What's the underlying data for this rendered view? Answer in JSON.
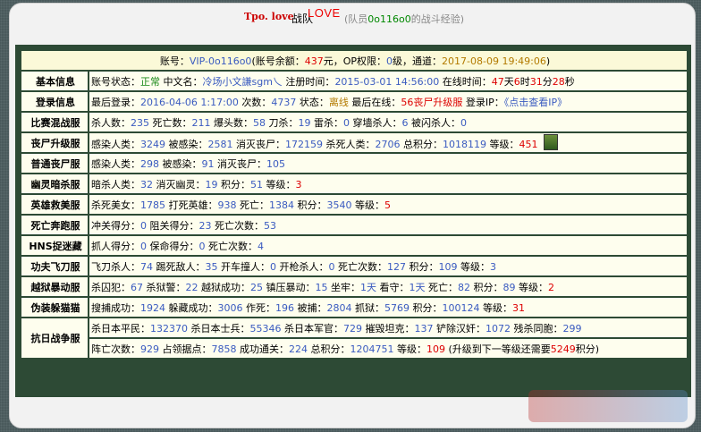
{
  "header": {
    "team": "Tpo. love",
    "team_suffix": "战队",
    "love": "LOVE",
    "sub_prefix": "(队员",
    "sub_name": "0o116o0",
    "sub_suffix": "的战斗经验)"
  },
  "info": {
    "p1": "账号：",
    "account": "VIP-0o116o0",
    "p2": "(账号余额：",
    "balance": "437",
    "p3": "元，OP权限：",
    "op": "0",
    "p4": "级，通道：",
    "date": "2017-08-09 19:49:06",
    "p5": ")"
  },
  "rows": [
    {
      "label": "基本信息",
      "parts": [
        {
          "t": "账号状态："
        },
        {
          "t": "正常",
          "c": "g"
        },
        {
          "t": " 中文名："
        },
        {
          "t": "冷场小文謙sgm乀",
          "c": "v"
        },
        {
          "t": " 注册时间："
        },
        {
          "t": "2015-03-01 14:56:00",
          "c": "v"
        },
        {
          "t": " 在线时间："
        },
        {
          "t": "47",
          "c": "r"
        },
        {
          "t": "天"
        },
        {
          "t": "6",
          "c": "r"
        },
        {
          "t": "时"
        },
        {
          "t": "31",
          "c": "r"
        },
        {
          "t": "分"
        },
        {
          "t": "28",
          "c": "r"
        },
        {
          "t": "秒"
        }
      ]
    },
    {
      "label": "登录信息",
      "parts": [
        {
          "t": "最后登录："
        },
        {
          "t": "2016-04-06 1:17:00",
          "c": "v"
        },
        {
          "t": " 次数："
        },
        {
          "t": "4737",
          "c": "v"
        },
        {
          "t": " 状态："
        },
        {
          "t": "离线",
          "c": "o"
        },
        {
          "t": " 最后在线："
        },
        {
          "t": "56丧尸升级服",
          "c": "r"
        },
        {
          "t": " 登录IP："
        },
        {
          "t": "《点击查看IP》",
          "c": "v"
        }
      ]
    },
    {
      "label": "比赛混战服",
      "parts": [
        {
          "t": "杀人数："
        },
        {
          "t": "235",
          "c": "v"
        },
        {
          "t": " 死亡数："
        },
        {
          "t": "211",
          "c": "v"
        },
        {
          "t": " 爆头数："
        },
        {
          "t": "58",
          "c": "v"
        },
        {
          "t": " 刀杀："
        },
        {
          "t": "19",
          "c": "v"
        },
        {
          "t": " 雷杀："
        },
        {
          "t": "0",
          "c": "v"
        },
        {
          "t": " 穿墙杀人："
        },
        {
          "t": "6",
          "c": "v"
        },
        {
          "t": " 被闪杀人："
        },
        {
          "t": "0",
          "c": "v"
        }
      ]
    },
    {
      "label": "丧尸升级服",
      "avatar": true,
      "parts": [
        {
          "t": "感染人类："
        },
        {
          "t": "3249",
          "c": "v"
        },
        {
          "t": " 被感染："
        },
        {
          "t": "2581",
          "c": "v"
        },
        {
          "t": " 消灭丧尸："
        },
        {
          "t": "172159",
          "c": "v"
        },
        {
          "t": " 杀死人类："
        },
        {
          "t": "2706",
          "c": "v"
        },
        {
          "t": " 总积分："
        },
        {
          "t": "1018119",
          "c": "v"
        },
        {
          "t": " 等级："
        },
        {
          "t": "451",
          "c": "r"
        }
      ]
    },
    {
      "label": "普通丧尸服",
      "parts": [
        {
          "t": "感染人类："
        },
        {
          "t": "298",
          "c": "v"
        },
        {
          "t": " 被感染："
        },
        {
          "t": "91",
          "c": "v"
        },
        {
          "t": " 消灭丧尸："
        },
        {
          "t": "105",
          "c": "v"
        }
      ]
    },
    {
      "label": "幽灵暗杀服",
      "parts": [
        {
          "t": "暗杀人类："
        },
        {
          "t": "32",
          "c": "v"
        },
        {
          "t": " 消灭幽灵："
        },
        {
          "t": "19",
          "c": "v"
        },
        {
          "t": " 积分："
        },
        {
          "t": "51",
          "c": "v"
        },
        {
          "t": " 等级："
        },
        {
          "t": "3",
          "c": "r"
        }
      ]
    },
    {
      "label": "英雄救美服",
      "parts": [
        {
          "t": "杀死美女："
        },
        {
          "t": "1785",
          "c": "v"
        },
        {
          "t": " 打死英雄："
        },
        {
          "t": "938",
          "c": "v"
        },
        {
          "t": " 死亡："
        },
        {
          "t": "1384",
          "c": "v"
        },
        {
          "t": " 积分："
        },
        {
          "t": "3540",
          "c": "v"
        },
        {
          "t": " 等级："
        },
        {
          "t": "5",
          "c": "r"
        }
      ]
    },
    {
      "label": "死亡奔跑服",
      "parts": [
        {
          "t": "冲关得分："
        },
        {
          "t": "0",
          "c": "v"
        },
        {
          "t": " 阻关得分："
        },
        {
          "t": "23",
          "c": "v"
        },
        {
          "t": " 死亡次数："
        },
        {
          "t": "53",
          "c": "v"
        }
      ]
    },
    {
      "label": "HNS捉迷藏",
      "parts": [
        {
          "t": "抓人得分："
        },
        {
          "t": "0",
          "c": "v"
        },
        {
          "t": " 保命得分："
        },
        {
          "t": "0",
          "c": "v"
        },
        {
          "t": " 死亡次数："
        },
        {
          "t": "4",
          "c": "v"
        }
      ]
    },
    {
      "label": "功夫飞刀服",
      "parts": [
        {
          "t": "飞刀杀人："
        },
        {
          "t": "74",
          "c": "v"
        },
        {
          "t": " 踢死敌人："
        },
        {
          "t": "35",
          "c": "v"
        },
        {
          "t": " 开车撞人："
        },
        {
          "t": "0",
          "c": "v"
        },
        {
          "t": " 开枪杀人："
        },
        {
          "t": "0",
          "c": "v"
        },
        {
          "t": " 死亡次数："
        },
        {
          "t": "127",
          "c": "v"
        },
        {
          "t": " 积分："
        },
        {
          "t": "109",
          "c": "v"
        },
        {
          "t": " 等级："
        },
        {
          "t": "3",
          "c": "v"
        }
      ]
    },
    {
      "label": "越狱暴动服",
      "parts": [
        {
          "t": "杀囚犯："
        },
        {
          "t": "67",
          "c": "v"
        },
        {
          "t": " 杀狱警："
        },
        {
          "t": "22",
          "c": "v"
        },
        {
          "t": " 越狱成功："
        },
        {
          "t": "25",
          "c": "v"
        },
        {
          "t": " 镇压暴动："
        },
        {
          "t": "15",
          "c": "v"
        },
        {
          "t": " 坐牢："
        },
        {
          "t": "1天",
          "c": "v"
        },
        {
          "t": " 看守："
        },
        {
          "t": "1天",
          "c": "v"
        },
        {
          "t": " 死亡："
        },
        {
          "t": "82",
          "c": "v"
        },
        {
          "t": " 积分："
        },
        {
          "t": "89",
          "c": "v"
        },
        {
          "t": " 等级："
        },
        {
          "t": "2",
          "c": "r"
        }
      ]
    },
    {
      "label": "伪装躲猫猫",
      "parts": [
        {
          "t": "搜捕成功："
        },
        {
          "t": "1924",
          "c": "v"
        },
        {
          "t": " 躲藏成功："
        },
        {
          "t": "3006",
          "c": "v"
        },
        {
          "t": " 作死："
        },
        {
          "t": "196",
          "c": "v"
        },
        {
          "t": " 被捕："
        },
        {
          "t": "2804",
          "c": "v"
        },
        {
          "t": " 抓狱："
        },
        {
          "t": "5769",
          "c": "v"
        },
        {
          "t": " 积分："
        },
        {
          "t": "100124",
          "c": "v"
        },
        {
          "t": " 等级："
        },
        {
          "t": "31",
          "c": "r"
        }
      ]
    }
  ],
  "war": {
    "label": "抗日战争服",
    "line1": [
      {
        "t": "杀日本平民："
      },
      {
        "t": "132370",
        "c": "v"
      },
      {
        "t": " 杀日本士兵："
      },
      {
        "t": "55346",
        "c": "v"
      },
      {
        "t": " 杀日本军官："
      },
      {
        "t": "729",
        "c": "v"
      },
      {
        "t": " 摧毁坦克："
      },
      {
        "t": "137",
        "c": "v"
      },
      {
        "t": " 铲除汉奸："
      },
      {
        "t": "1072",
        "c": "v"
      },
      {
        "t": " 残杀同胞："
      },
      {
        "t": "299",
        "c": "v"
      }
    ],
    "line2": [
      {
        "t": "阵亡次数："
      },
      {
        "t": "929",
        "c": "v"
      },
      {
        "t": " 占领据点："
      },
      {
        "t": "7858",
        "c": "v"
      },
      {
        "t": " 成功通关："
      },
      {
        "t": "224",
        "c": "v"
      },
      {
        "t": " 总积分："
      },
      {
        "t": "1204751",
        "c": "v"
      },
      {
        "t": " 等级："
      },
      {
        "t": "109",
        "c": "r"
      },
      {
        "t": " (升级到下一等级还需要"
      },
      {
        "t": "5249",
        "c": "r"
      },
      {
        "t": "积分)"
      }
    ]
  }
}
